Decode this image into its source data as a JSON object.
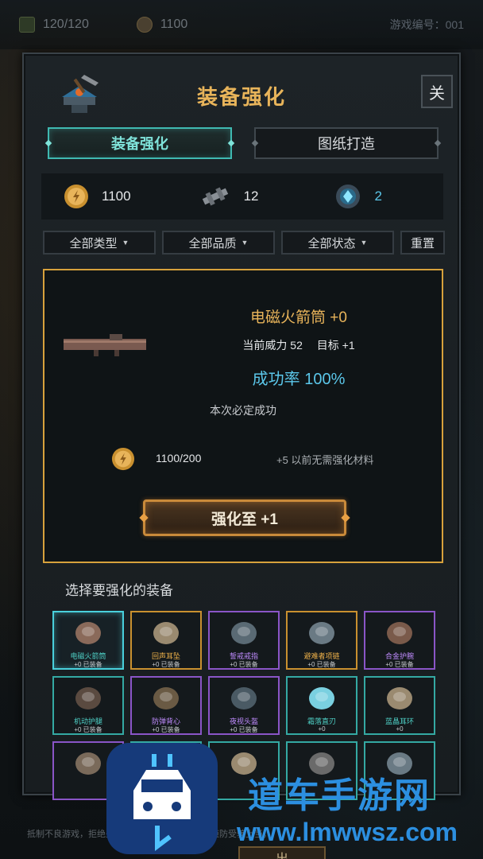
{
  "topbar": {
    "hp": "120/120",
    "coins": "1100",
    "serial": "游戏编号：001"
  },
  "panel": {
    "title": "装备强化",
    "close_label": "关"
  },
  "tabs": [
    {
      "label": "装备强化",
      "active": true
    },
    {
      "label": "图纸打造",
      "active": false
    }
  ],
  "resources": {
    "gold": "1100",
    "parts": "12",
    "gems": "2"
  },
  "filters": {
    "type": "全部类型",
    "quality": "全部品质",
    "status": "全部状态",
    "reset": "重置"
  },
  "detail": {
    "name": "电磁火箭筒 +0",
    "power_label": "当前威力 52",
    "target_label": "目标 +1",
    "success_rate": "成功率 100%",
    "note": "本次必定成功",
    "cost": "1100/200",
    "cost_note": "+5 以前无需强化材料",
    "enhance_button": "强化至 +1"
  },
  "select_title": "选择要强化的装备",
  "items": [
    {
      "name": "电磁火箭筒",
      "level": "+0  已装备",
      "quality": "teal",
      "selected": true,
      "icon": "rocket-launcher-icon"
    },
    {
      "name": "回声耳坠",
      "level": "+0  已装备",
      "quality": "gold",
      "selected": false,
      "icon": "earring-icon"
    },
    {
      "name": "誓戒戒指",
      "level": "+0  已装备",
      "quality": "purple",
      "selected": false,
      "icon": "ring-icon"
    },
    {
      "name": "避难者项链",
      "level": "+0  已装备",
      "quality": "gold",
      "selected": false,
      "icon": "necklace-icon"
    },
    {
      "name": "合金护腕",
      "level": "+0  已装备",
      "quality": "purple",
      "selected": false,
      "icon": "bracer-icon"
    },
    {
      "name": "机动护腿",
      "level": "+0  已装备",
      "quality": "teal",
      "selected": false,
      "icon": "leg-armor-icon"
    },
    {
      "name": "防弹背心",
      "level": "+0  已装备",
      "quality": "purple",
      "selected": false,
      "icon": "vest-icon"
    },
    {
      "name": "夜视头盔",
      "level": "+0  已装备",
      "quality": "purple",
      "selected": false,
      "icon": "helmet-icon"
    },
    {
      "name": "霜落直刃",
      "level": "+0",
      "quality": "teal",
      "selected": false,
      "icon": "blade-icon"
    },
    {
      "name": "蓝晶耳环",
      "level": "+0",
      "quality": "teal",
      "selected": false,
      "icon": "earring-icon"
    },
    {
      "name": "",
      "level": "",
      "quality": "purple",
      "selected": false,
      "icon": "shotgun-icon"
    },
    {
      "name": "",
      "level": "",
      "quality": "teal",
      "selected": false,
      "icon": "unknown-icon"
    },
    {
      "name": "",
      "level": "",
      "quality": "teal",
      "selected": false,
      "icon": "earring-icon"
    },
    {
      "name": "",
      "level": "",
      "quality": "teal",
      "selected": false,
      "icon": "pistol-icon"
    },
    {
      "name": "",
      "level": "",
      "quality": "teal",
      "selected": false,
      "icon": "necklace-icon"
    }
  ],
  "footer": {
    "exit_label": "出",
    "bottom_text": "抵制不良游戏，拒绝盗版游戏。注意自我保护，谨防受骗上当。"
  },
  "watermark": {
    "brand": "道车手游网",
    "url": "www.lmwwsz.com"
  },
  "colors": {
    "accent_gold": "#e8b45a",
    "accent_teal": "#3fb9b1",
    "accent_blue": "#5bc7ea",
    "quality_purple": "#8a55c7"
  }
}
